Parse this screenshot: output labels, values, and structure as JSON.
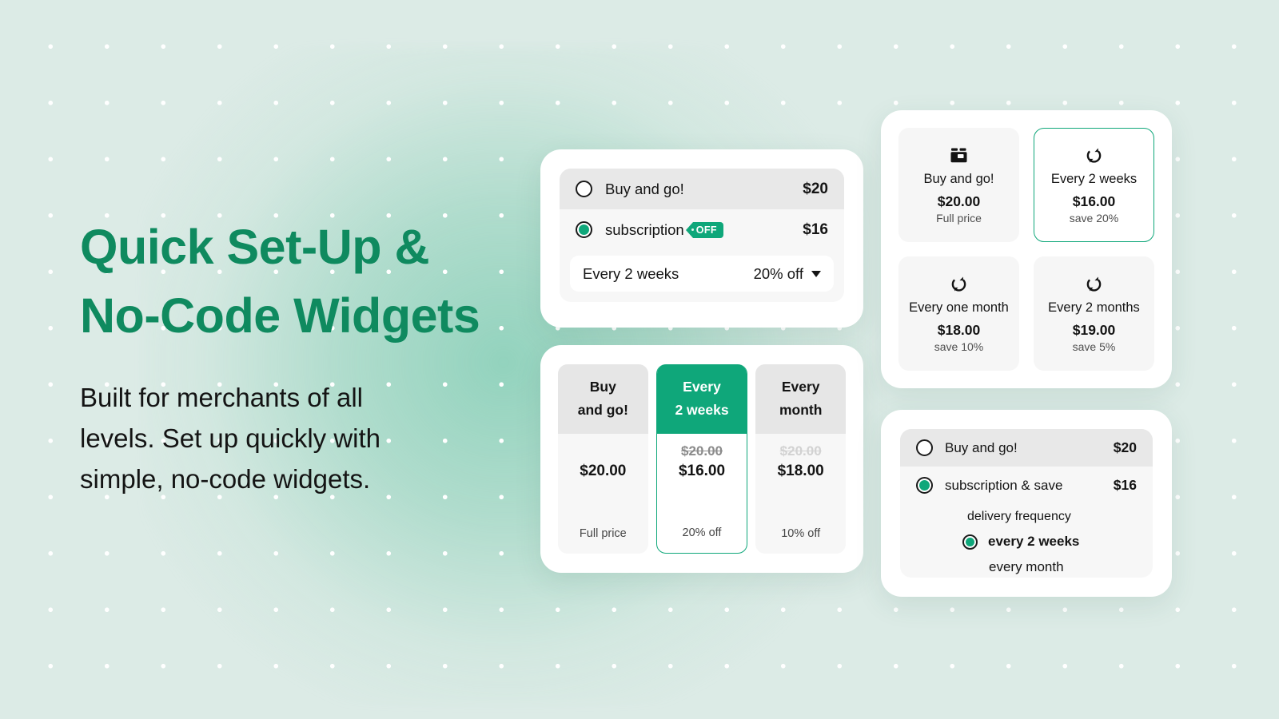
{
  "theme": {
    "brand_green": "#0fa77a",
    "title_green": "#0f8a5f",
    "background": "#dcebe6",
    "card_white": "#ffffff"
  },
  "hero": {
    "title": "Quick Set-Up &\nNo-Code Widgets",
    "subtitle": "Built for merchants of all\nlevels. Set up quickly with\nsimple, no-code widgets."
  },
  "widget_radio_simple": {
    "options": [
      {
        "label": "Buy and go!",
        "price": "$20",
        "selected": false
      },
      {
        "label": "subscription",
        "price": "$16",
        "selected": true,
        "tag": "OFF"
      }
    ],
    "frequency_select": {
      "value": "Every 2 weeks",
      "discount": "20% off",
      "caret_icon": "chevron-down-icon"
    }
  },
  "widget_columns": {
    "columns": [
      {
        "title": "Buy\nand go!",
        "strike_price": "",
        "price": "$20.00",
        "note": "Full price",
        "active": false
      },
      {
        "title": "Every\n2 weeks",
        "strike_price": "$20.00",
        "price": "$16.00",
        "note": "20% off",
        "active": true
      },
      {
        "title": "Every\nmonth",
        "strike_price": "$20.00",
        "price": "$18.00",
        "note": "10% off",
        "active": false
      }
    ]
  },
  "widget_grid": {
    "cells": [
      {
        "icon": "box-icon",
        "title": "Buy and go!",
        "price": "$20.00",
        "note": "Full price",
        "selected": false
      },
      {
        "icon": "refresh-icon",
        "title": "Every 2 weeks",
        "price": "$16.00",
        "note": "save 20%",
        "selected": true
      },
      {
        "icon": "refresh-icon",
        "title": "Every one month",
        "price": "$18.00",
        "note": "save 10%",
        "selected": false
      },
      {
        "icon": "refresh-icon",
        "title": "Every 2 months",
        "price": "$19.00",
        "note": "save 5%",
        "selected": false
      }
    ]
  },
  "widget_radio_nested": {
    "options": [
      {
        "label": "Buy and go!",
        "price": "$20",
        "selected": false
      },
      {
        "label": "subscription & save",
        "price": "$16",
        "selected": true
      }
    ],
    "sub_heading": "delivery frequency",
    "sub_options": [
      {
        "label": "every 2 weeks",
        "selected": true
      },
      {
        "label": "every month",
        "selected": false
      }
    ]
  }
}
